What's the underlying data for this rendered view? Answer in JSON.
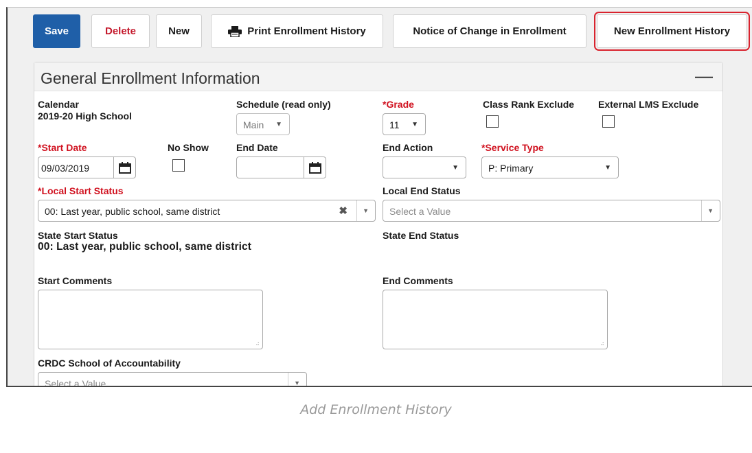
{
  "toolbar": {
    "save_label": "Save",
    "delete_label": "Delete",
    "new_label": "New",
    "print_history_label": "Print Enrollment History",
    "notice_label": "Notice of Change in Enrollment",
    "new_history_label": "New Enrollment History"
  },
  "panel": {
    "title": "General Enrollment Information",
    "collapse_glyph": "—"
  },
  "fields": {
    "calendar": {
      "label": "Calendar",
      "value": "2019-20 High School"
    },
    "schedule": {
      "label": "Schedule (read only)",
      "value": "Main"
    },
    "grade": {
      "label": "*Grade",
      "value": "11"
    },
    "class_rank_exclude": {
      "label": "Class Rank Exclude",
      "checked": false
    },
    "external_lms_exclude": {
      "label": "External LMS Exclude",
      "checked": false
    },
    "start_date": {
      "label": "*Start Date",
      "value": "09/03/2019"
    },
    "no_show": {
      "label": "No Show",
      "checked": false
    },
    "end_date": {
      "label": "End Date",
      "value": ""
    },
    "end_action": {
      "label": "End Action",
      "value": ""
    },
    "service_type": {
      "label": "*Service Type",
      "value": "P: Primary"
    },
    "local_start_status": {
      "label": "*Local Start Status",
      "value": "00: Last year, public school, same district"
    },
    "local_end_status": {
      "label": "Local End Status",
      "placeholder": "Select a Value"
    },
    "state_start_status": {
      "label": "State Start Status",
      "value": "00: Last year, public school, same district"
    },
    "state_end_status": {
      "label": "State End Status",
      "value": ""
    },
    "start_comments": {
      "label": "Start Comments",
      "value": ""
    },
    "end_comments": {
      "label": "End Comments",
      "value": ""
    },
    "crdc_school": {
      "label": "CRDC School of Accountability",
      "placeholder": "Select a Value"
    }
  },
  "icons": {
    "printer": "printer-icon",
    "calendar": "calendar-icon",
    "dropdown": "chevron-down-icon",
    "clear": "close-icon"
  },
  "glyphs": {
    "clear": "✖",
    "caret": "▼",
    "grip": "⠴"
  },
  "colors": {
    "primary": "#1f5fa8",
    "danger": "#c4182b",
    "required": "#d0101e",
    "highlight": "#d9232e"
  },
  "caption": "Add Enrollment History"
}
